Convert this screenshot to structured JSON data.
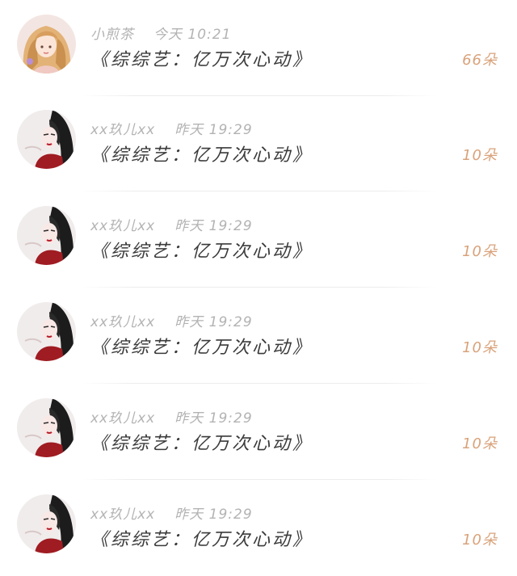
{
  "gift_list": {
    "items": [
      {
        "user": "小煎茶",
        "time": "今天 10:21",
        "title": "《综综艺：亿万次心动》",
        "count": "66朵",
        "avatar_icon": "blonde-girl-avatar"
      },
      {
        "user": "xx玖儿xx",
        "time": "昨天 19:29",
        "title": "《综综艺：亿万次心动》",
        "count": "10朵",
        "avatar_icon": "dark-hair-girl-avatar"
      },
      {
        "user": "xx玖儿xx",
        "time": "昨天 19:29",
        "title": "《综综艺：亿万次心动》",
        "count": "10朵",
        "avatar_icon": "dark-hair-girl-avatar"
      },
      {
        "user": "xx玖儿xx",
        "time": "昨天 19:29",
        "title": "《综综艺：亿万次心动》",
        "count": "10朵",
        "avatar_icon": "dark-hair-girl-avatar"
      },
      {
        "user": "xx玖儿xx",
        "time": "昨天 19:29",
        "title": "《综综艺：亿万次心动》",
        "count": "10朵",
        "avatar_icon": "dark-hair-girl-avatar"
      },
      {
        "user": "xx玖儿xx",
        "time": "昨天 19:29",
        "title": "《综综艺：亿万次心动》",
        "count": "10朵",
        "avatar_icon": "dark-hair-girl-avatar"
      }
    ]
  },
  "colors": {
    "count_accent": "#d9a27a",
    "meta_text": "#b3b3b3",
    "title_text": "#3a3a3a"
  }
}
